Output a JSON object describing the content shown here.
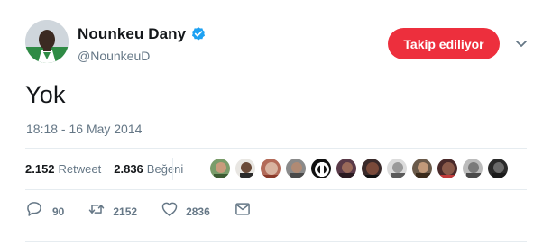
{
  "user": {
    "display_name": "Nounkeu Dany",
    "handle": "@NounkeuD",
    "verified": true
  },
  "follow_button_label": "Takip ediliyor",
  "tweet": {
    "text": "Yok",
    "timestamp": "18:18 - 16 May 2014"
  },
  "stats": {
    "retweets": {
      "count": "2.152",
      "label": "Retweet"
    },
    "likes": {
      "count": "2.836",
      "label": "Beğeni"
    }
  },
  "actions": {
    "reply_count": "90",
    "retweet_count": "2152",
    "like_count": "2836"
  },
  "colors": {
    "follow_button": "#ed2f3d",
    "verified_badge": "#1da1f2",
    "secondary_text": "#657786",
    "divider": "#e6ecf0"
  },
  "icons": [
    "verified-badge-icon",
    "chevron-down-icon",
    "reply-icon",
    "retweet-icon",
    "like-icon",
    "direct-message-icon"
  ]
}
